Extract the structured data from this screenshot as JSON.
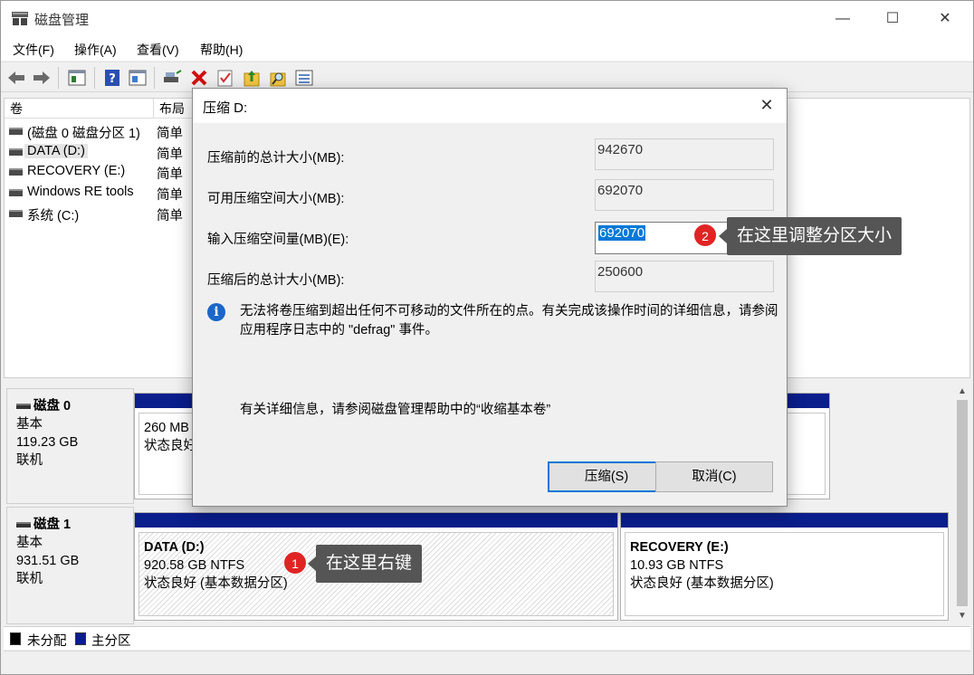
{
  "window": {
    "title": "磁盘管理",
    "minimize": "—",
    "maximize": "☐",
    "close": "✕"
  },
  "menu": [
    "文件(F)",
    "操作(A)",
    "查看(V)",
    "帮助(H)"
  ],
  "toolbar_icons": [
    "back-arrow-icon",
    "forward-arrow-icon",
    "console-tree-icon",
    "help-icon",
    "properties-icon",
    "connect-icon",
    "delete-icon",
    "check-icon",
    "export-icon",
    "search-icon",
    "list-icon"
  ],
  "volume_list": {
    "columns": [
      "卷",
      "布局"
    ],
    "rows": [
      {
        "name": "(磁盘 0 磁盘分区 1)",
        "layout": "简单"
      },
      {
        "name": "DATA (D:)",
        "layout": "简单"
      },
      {
        "name": "RECOVERY (E:)",
        "layout": "简单"
      },
      {
        "name": "Windows RE tools",
        "layout": "简单"
      },
      {
        "name": "系统 (C:)",
        "layout": "简单"
      }
    ]
  },
  "disks": [
    {
      "name": "磁盘 0",
      "type": "基本",
      "size": "119.23 GB",
      "status": "联机"
    },
    {
      "name": "磁盘 1",
      "type": "基本",
      "size": "931.51 GB",
      "status": "联机"
    }
  ],
  "disk0_partition": {
    "size": "260 MB",
    "status": "状态良好"
  },
  "disk1_partitions": [
    {
      "name": "DATA  (D:)",
      "size": "920.58 GB NTFS",
      "status": "状态良好 (基本数据分区)"
    },
    {
      "name": "RECOVERY  (E:)",
      "size": "10.93 GB NTFS",
      "status": "状态良好 (基本数据分区)"
    }
  ],
  "legend": [
    {
      "label": "未分配",
      "color": "#000000"
    },
    {
      "label": "主分区",
      "color": "#0a1e8c"
    }
  ],
  "dialog": {
    "title": "压缩 D:",
    "close": "✕",
    "fields": [
      {
        "label": "压缩前的总计大小(MB):",
        "value": "942670"
      },
      {
        "label": "可用压缩空间大小(MB):",
        "value": "692070"
      },
      {
        "label": "输入压缩空间量(MB)(E):",
        "value": "692070"
      },
      {
        "label": "压缩后的总计大小(MB):",
        "value": "250600"
      }
    ],
    "info_icon": "i",
    "info": "无法将卷压缩到超出任何不可移动的文件所在的点。有关完成该操作时间的详细信息，请参阅应用程序日志中的 \"defrag\" 事件。",
    "help": "有关详细信息，请参阅磁盘管理帮助中的“收缩基本卷”",
    "ok": "压缩(S)",
    "cancel": "取消(C)"
  },
  "annotations": [
    {
      "number": "1",
      "text": "在这里右键"
    },
    {
      "number": "2",
      "text": "在这里调整分区大小"
    }
  ]
}
